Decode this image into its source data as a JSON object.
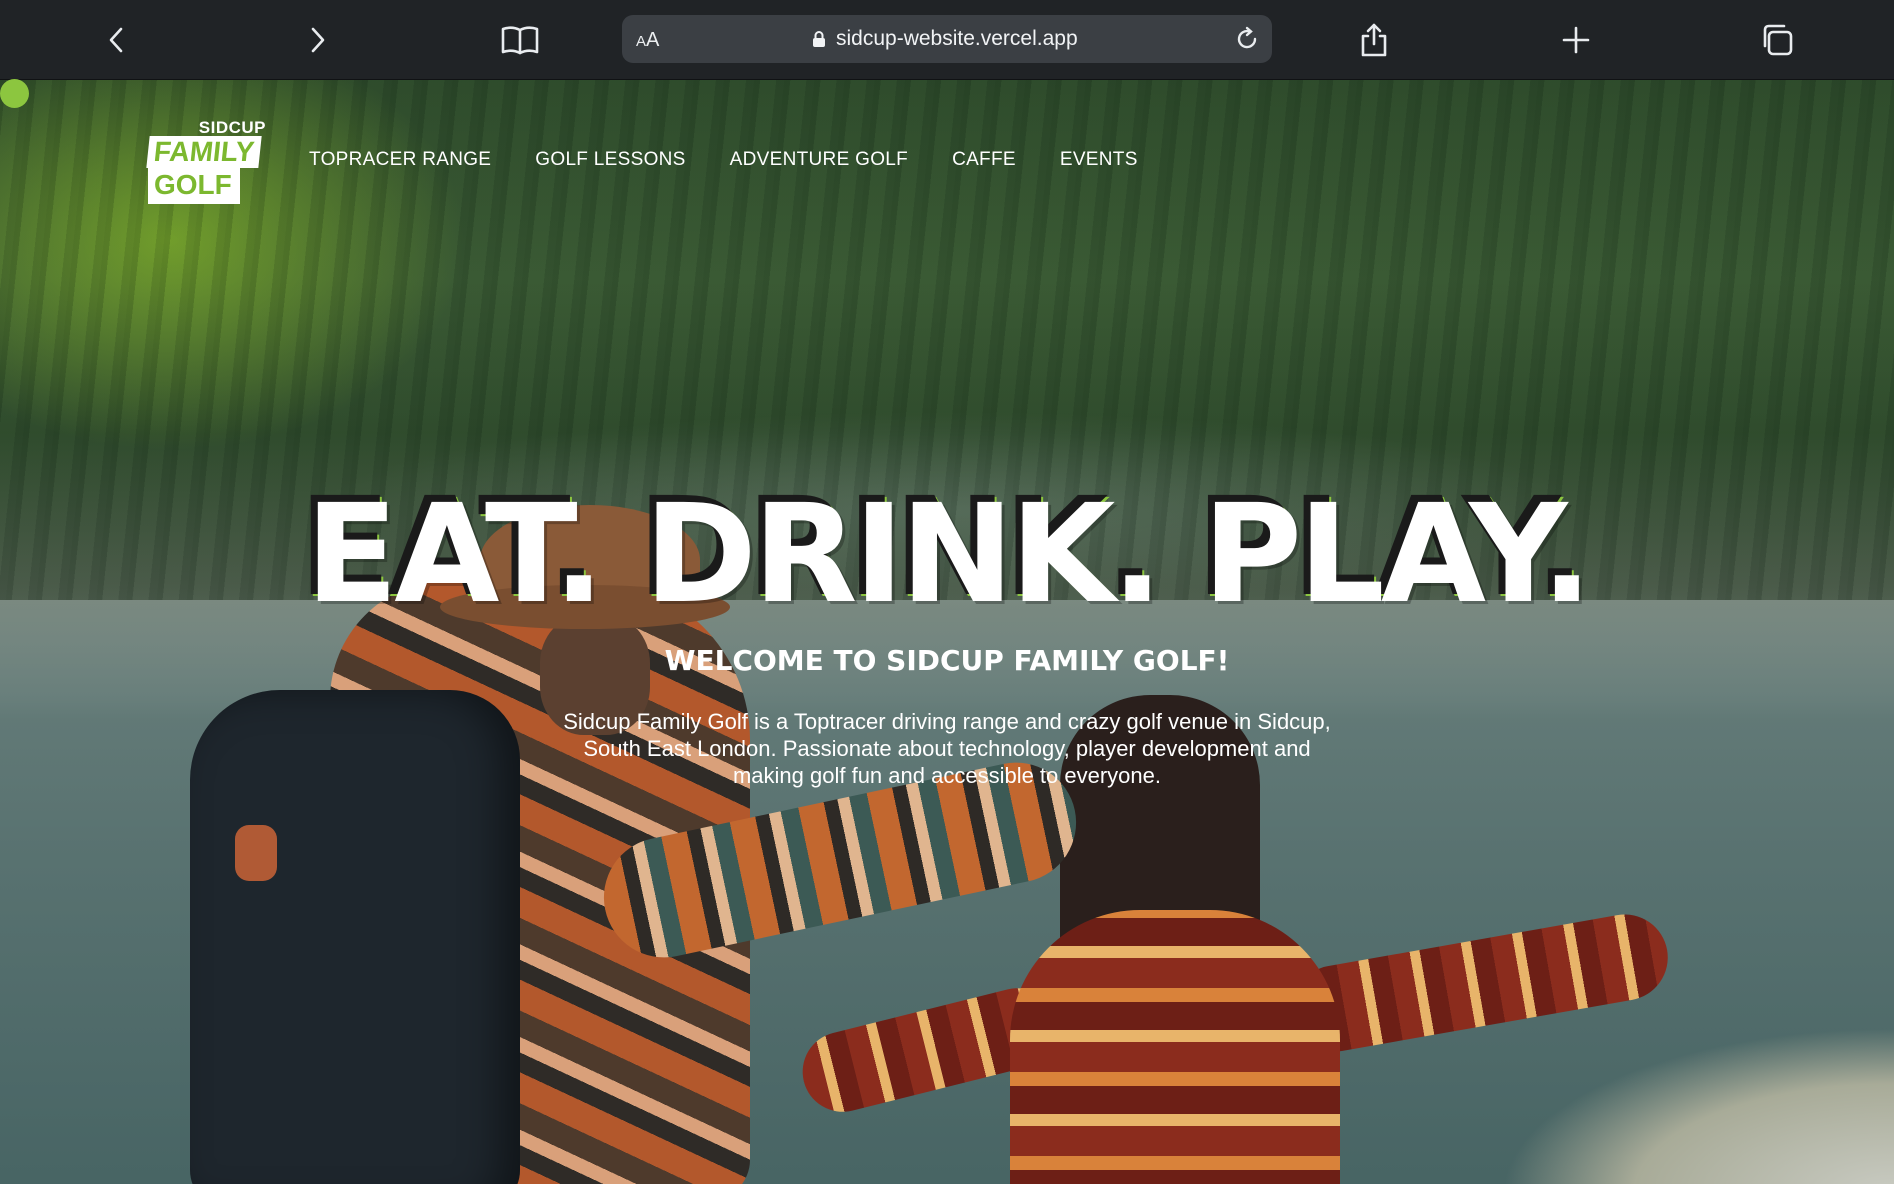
{
  "browser": {
    "reader_label": "AA",
    "url": "sidcup-website.vercel.app",
    "icons": [
      "back-icon",
      "forward-icon",
      "bookmarks-icon",
      "lock-icon",
      "reload-icon",
      "share-icon",
      "new-tab-icon",
      "tabs-icon"
    ]
  },
  "logo": {
    "top": "SIDCUP",
    "line1": "FAMILY",
    "line2": "GOLF"
  },
  "nav": {
    "items": [
      "TOPRACER RANGE",
      "GOLF LESSONS",
      "ADVENTURE GOLF",
      "CAFFE",
      "EVENTS"
    ]
  },
  "hero": {
    "headline": "EAT. DRINK. PLAY.",
    "subtitle": "WELCOME TO SIDCUP FAMILY GOLF!",
    "description": "Sidcup Family Golf is a Toptracer driving range and crazy golf venue in Sidcup, South East London. Passionate about technology, player development and making golf fun and accessible to everyone."
  },
  "colors": {
    "accent": "#8cc63f",
    "chrome": "#202326",
    "urlbar": "#3b3f44"
  }
}
